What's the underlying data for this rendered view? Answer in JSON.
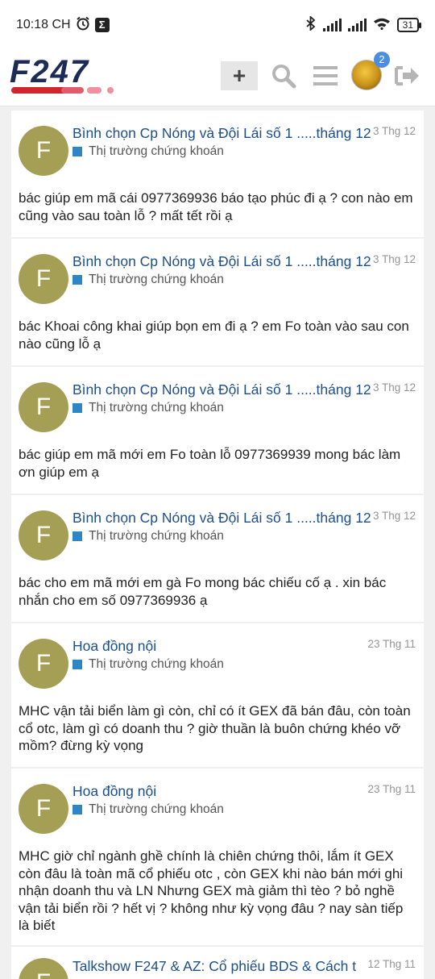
{
  "status_bar": {
    "time": "10:18 CH",
    "alarm_icon": "alarm-clock-icon",
    "app_icon": "sigma-icon",
    "bluetooth_icon": "bluetooth-icon",
    "wifi_icon": "wifi-icon",
    "battery": "31"
  },
  "header": {
    "logo_text": "F247",
    "plus_icon": "plus-icon",
    "search_icon": "search-icon",
    "menu_icon": "hamburger-menu-icon",
    "notification_count": "2",
    "logout_icon": "logout-icon"
  },
  "posts": [
    {
      "avatar": "F",
      "title": "Bình chọn Cp Nóng và Đội Lái số 1 .....tháng 12",
      "date": "3 Thg 12",
      "category": "Thị trường chứng khoán",
      "body": "bác giúp em mã cái 0977369936 báo tạo phúc đi ạ ? con nào em cũng vào sau toàn lỗ ? mất tết rồi ạ"
    },
    {
      "avatar": "F",
      "title": "Bình chọn Cp Nóng và Đội Lái số 1 .....tháng 12",
      "date": "3 Thg 12",
      "category": "Thị trường chứng khoán",
      "body": "bác Khoai công khai giúp bọn em đi ạ ? em Fo toàn vào sau con nào cũng lỗ ạ"
    },
    {
      "avatar": "F",
      "title": "Bình chọn Cp Nóng và Đội Lái số 1 .....tháng 12",
      "date": "3 Thg 12",
      "category": "Thị trường chứng khoán",
      "body": "bác giúp em mã mới em Fo toàn lỗ 0977369939 mong bác làm ơn giúp em ạ"
    },
    {
      "avatar": "F",
      "title": "Bình chọn Cp Nóng và Đội Lái số 1 .....tháng 12",
      "date": "3 Thg 12",
      "category": "Thị trường chứng khoán",
      "body": "bác cho em mã mới em gà Fo mong bác chiếu cố ạ . xin bác nhắn cho em số 0977369936 ạ"
    },
    {
      "avatar": "F",
      "title": "Hoa đồng nội",
      "date": "23 Thg 11",
      "category": "Thị trường chứng khoán",
      "body": "MHC vận tải biển làm gì còn, chỉ có ít GEX đã bán đâu, còn toàn cổ otc, làm gì có doanh thu ? giờ thuần là buôn chứng khéo vỡ mồm? đừng kỳ vọng"
    },
    {
      "avatar": "F",
      "title": "Hoa đồng nội",
      "date": "23 Thg 11",
      "category": "Thị trường chứng khoán",
      "body": "MHC giờ chỉ ngành ghề chính là chiên chứng thôi, lắm ít GEX còn đâu là toàn mã cổ phiếu otc , còn GEX khi nào bán mới ghi nhận doanh thu và LN Nhưng GEX mà giảm thì tèo ? bỏ nghề vận tải biển rồi ? hết vị ? không như kỳ vọng đâu ? nay sàn tiếp là biết"
    },
    {
      "avatar": "F",
      "title": "Talkshow F247 & AZ: Cổ phiếu BDS & Cách t",
      "date": "12 Thg 11",
      "category": "",
      "body": ""
    }
  ]
}
